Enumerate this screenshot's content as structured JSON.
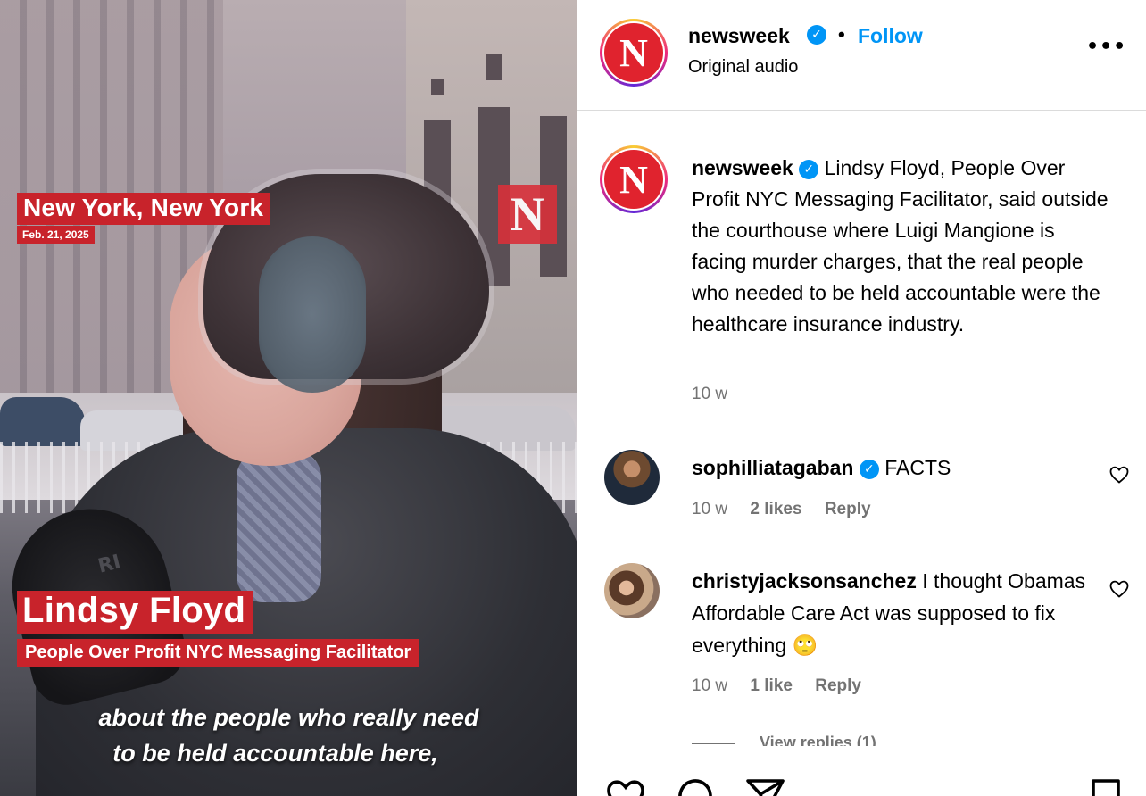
{
  "video": {
    "location": "New York, New York",
    "date": "Feb. 21, 2025",
    "logo_letter": "N",
    "name": "Lindsy Floyd",
    "role": "People Over Profit NYC Messaging Facilitator",
    "subtitle_line1": "about the people who really need",
    "subtitle_line2": "to be held accountable here,",
    "mic_text": "RI"
  },
  "header": {
    "logo_letter": "N",
    "username": "newsweek",
    "separator": "•",
    "follow_label": "Follow",
    "audio_label": "Original audio",
    "more_label": "•••",
    "verified_icon": "verified-badge-icon"
  },
  "post": {
    "username": "newsweek",
    "caption": "Lindsy Floyd, People Over Profit NYC Messaging Facilitator, said outside the courthouse where Luigi Mangione is facing murder charges, that the real people who needed to be held accountable were the healthcare insurance industry.",
    "time": "10 w"
  },
  "comments": [
    {
      "username": "sophilliatagaban",
      "text": "FACTS",
      "time": "10 w",
      "likes": "2 likes",
      "reply_label": "Reply",
      "verified": true
    },
    {
      "username": "christyjacksonsanchez",
      "text": "I thought Obamas Affordable Care Act was supposed to fix everything",
      "emoji": "🙄",
      "time": "10 w",
      "likes": "1 like",
      "reply_label": "Reply",
      "verified": false
    }
  ],
  "view_replies": "View replies (1)",
  "colors": {
    "accent_blue": "#0095f6",
    "newsweek_red": "#e0232e",
    "lower_third_red": "#c8232b",
    "secondary_text": "#737373"
  }
}
